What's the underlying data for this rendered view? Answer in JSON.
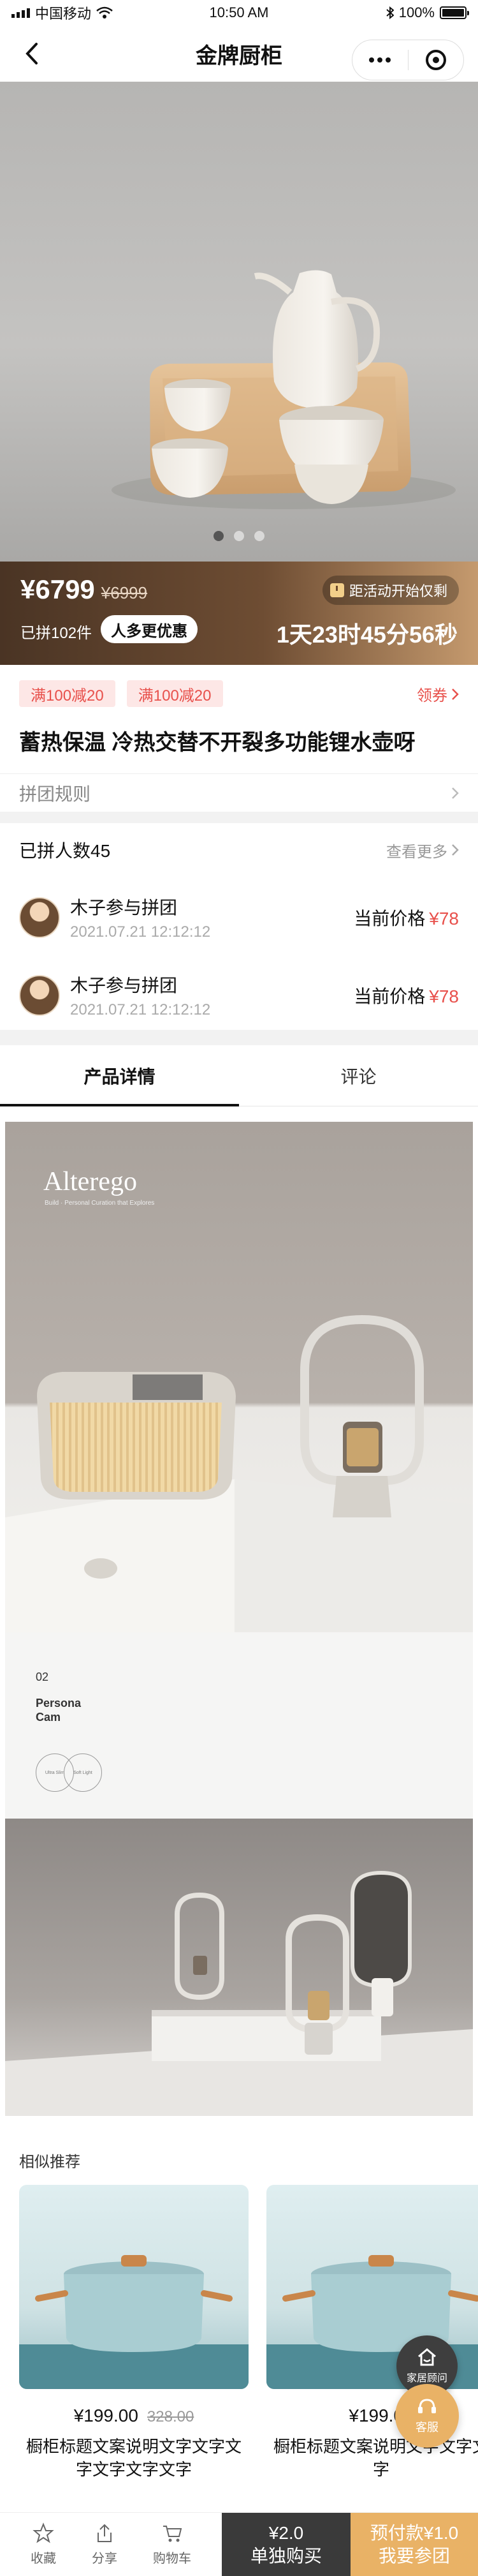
{
  "status_bar": {
    "carrier": "中国移动",
    "time": "10:50 AM",
    "battery": "100%",
    "battery_level": 1.0
  },
  "nav": {
    "title": "金牌厨柜"
  },
  "hero": {
    "slide_count": 3,
    "active_slide": 1
  },
  "price_bar": {
    "price": "¥6799",
    "original_price": "¥6999",
    "joined": "已拼102件",
    "badge": "人多更优惠",
    "countdown_label": "距活动开始仅剩",
    "countdown": "1天23时45分56秒"
  },
  "info": {
    "coupons": [
      "满100减20",
      "满100减20"
    ],
    "coupon_link": "领券",
    "title": "蓄热保温 冷热交替不开裂多功能锂水壶呀",
    "rule": "拼团规则"
  },
  "group": {
    "heading": "已拼人数45",
    "more": "查看更多",
    "members": [
      {
        "name": "木子参与拼团",
        "time": "2021.07.21 12:12:12",
        "price_label": "当前价格",
        "price": "¥78"
      },
      {
        "name": "木子参与拼团",
        "time": "2021.07.21 12:12:12",
        "price_label": "当前价格",
        "price": "¥78"
      }
    ]
  },
  "tabs": [
    "产品详情",
    "评论"
  ],
  "detail": {
    "brand": "Alterego",
    "brand_sub": "Build · Personal Curation that Explores",
    "number": "02",
    "name": "Persona\nCam",
    "circle_left": "Ultra Slim",
    "circle_right": "Soft Light"
  },
  "similar": {
    "title": "相似推荐",
    "items": [
      {
        "price": "¥199.00",
        "old_price": "328.00",
        "desc": "橱柜标题文案说明文字文字文字文字文字文字"
      },
      {
        "price": "¥199.00",
        "old_price": "",
        "desc": "橱柜标题文案说明文字文字文字"
      }
    ]
  },
  "float": {
    "home": "家居顾问",
    "service": "客服"
  },
  "bottom_bar": {
    "fav": "收藏",
    "share": "分享",
    "cart": "购物车",
    "solo_price": "¥2.0",
    "solo_label": "单独购买",
    "group_price": "预付款¥1.0",
    "group_label": "我要参团"
  },
  "colors": {
    "accent_red": "#e8504b",
    "gold": "#e9b266",
    "dark": "#3a3a3a",
    "brown": "#6e4d33"
  }
}
